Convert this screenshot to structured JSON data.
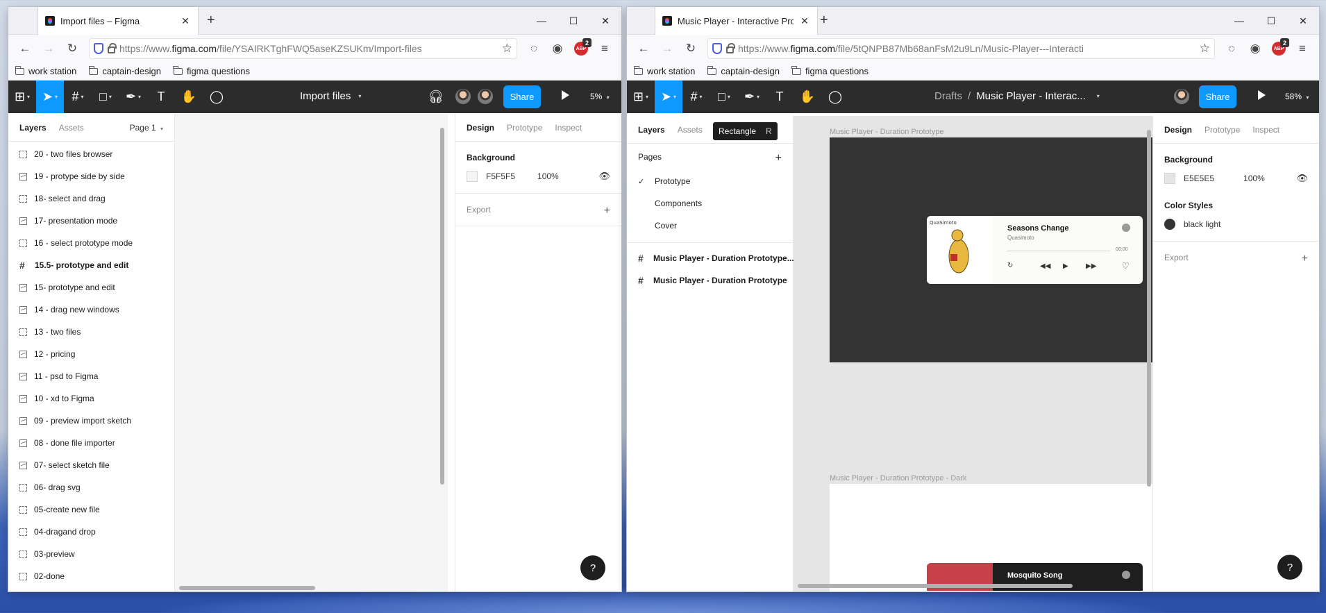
{
  "left": {
    "tab_title": "Import files – Figma",
    "url_prefix": "https://www.",
    "url_host": "figma.com",
    "url_path": "/file/YSAIRKTghFWQ5aseKZSUKm/Import-files",
    "file_name": "Import files",
    "zoom": "5%",
    "share_label": "Share",
    "panel_tabs": [
      "Layers",
      "Assets"
    ],
    "page_selector": "Page 1",
    "layers": [
      {
        "label": "20 - two files  browser",
        "icon": "frame-icon",
        "bold": false
      },
      {
        "label": "19 - protype side by side",
        "icon": "image-icon",
        "bold": false
      },
      {
        "label": "18- select and drag",
        "icon": "frame-icon",
        "bold": false
      },
      {
        "label": "17- presentation mode",
        "icon": "image-icon",
        "bold": false
      },
      {
        "label": "16 - select prototype mode",
        "icon": "frame-icon",
        "bold": false
      },
      {
        "label": "15.5- prototype and edit",
        "icon": "grid-icon",
        "bold": true
      },
      {
        "label": "15- prototype and edit",
        "icon": "image-icon",
        "bold": false
      },
      {
        "label": "14 - drag new windows",
        "icon": "image-icon",
        "bold": false
      },
      {
        "label": "13 - two files",
        "icon": "frame-icon",
        "bold": false
      },
      {
        "label": "12 - pricing",
        "icon": "image-icon",
        "bold": false
      },
      {
        "label": "11 - psd to Figma",
        "icon": "image-icon",
        "bold": false
      },
      {
        "label": "10 - xd to Figma",
        "icon": "image-icon",
        "bold": false
      },
      {
        "label": "09 - preview import sketch",
        "icon": "image-icon",
        "bold": false
      },
      {
        "label": "08 - done file importer",
        "icon": "image-icon",
        "bold": false
      },
      {
        "label": "07- select sketch file",
        "icon": "image-icon",
        "bold": false
      },
      {
        "label": "06- drag svg",
        "icon": "frame-icon",
        "bold": false
      },
      {
        "label": "05-create new file",
        "icon": "frame-icon",
        "bold": false
      },
      {
        "label": "04-dragand  drop",
        "icon": "frame-icon",
        "bold": false
      },
      {
        "label": "03-preview",
        "icon": "frame-icon",
        "bold": false
      },
      {
        "label": "02-done",
        "icon": "frame-icon",
        "bold": false
      }
    ],
    "design_tabs": [
      "Design",
      "Prototype",
      "Inspect"
    ],
    "background_label": "Background",
    "bg_hex": "F5F5F5",
    "bg_color": "#f5f5f5",
    "bg_opacity": "100%",
    "export_label": "Export"
  },
  "right": {
    "tab_title": "Music Player - Interactive Proto",
    "url_prefix": "https://www.",
    "url_host": "figma.com",
    "url_path": "/file/5tQNPB87Mb68anFsM2u9Ln/Music-Player---Interacti",
    "breadcrumb_root": "Drafts",
    "breadcrumb_sep": "/",
    "file_name": "Music Player - Interac...",
    "zoom": "58%",
    "share_label": "Share",
    "panel_tabs": [
      "Layers",
      "Assets"
    ],
    "tooltip_label": "Rectangle",
    "tooltip_key": "R",
    "pages_label": "Pages",
    "pages": [
      "Prototype",
      "Components",
      "Cover"
    ],
    "layers": [
      "Music Player - Duration Prototype...",
      "Music Player - Duration Prototype"
    ],
    "design_tabs": [
      "Design",
      "Prototype",
      "Inspect"
    ],
    "background_label": "Background",
    "bg_hex": "E5E5E5",
    "bg_color": "#e5e5e5",
    "bg_opacity": "100%",
    "color_styles_label": "Color Styles",
    "color_style_name": "black light",
    "color_style_color": "#333333",
    "export_label": "Export",
    "frame1_label": "Music Player - Duration Prototype",
    "frame2_label": "Music Player - Duration Prototype - Dark",
    "song_title": "Seasons Change",
    "song_artist": "Quasimoto",
    "song_time": "00:00",
    "song2_title": "Mosquito Song"
  },
  "bookmarks": [
    "work station",
    "captain-design",
    "figma questions"
  ],
  "icons": {
    "close": "✕",
    "newtab": "+",
    "minimize": "—",
    "maximize": "☐",
    "back": "←",
    "forward": "→",
    "reload": "↻",
    "star": "☆",
    "menu": "≡",
    "help": "?",
    "add": "+",
    "check": "✓"
  }
}
